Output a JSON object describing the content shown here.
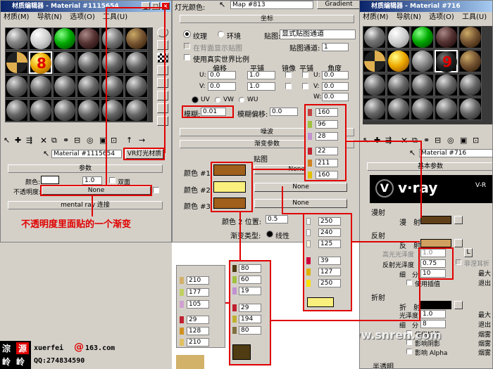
{
  "left": {
    "title": "材质编辑器 - Material #1115654",
    "menu": [
      "材质(M)",
      "导航(N)",
      "选项(O)",
      "工具(U)"
    ],
    "slot8": "8",
    "material_name": "Material #1115654",
    "material_type": "VR灯光材质",
    "params_header": "参数",
    "color_label": "颜色:",
    "color_value": "1.0",
    "double_sided": "双面",
    "opacity_label": "不透明度:",
    "opacity_value": "None",
    "mr_header": "mental ray 连接",
    "annotation": "不透明度里面贴的一个渐变",
    "watermark_name": "xuerfei",
    "watermark_domain": "163.com",
    "watermark_qq": "QQ:274834590",
    "stamp": [
      "淙",
      "源",
      "岭",
      "岭"
    ]
  },
  "middle": {
    "top_label": "灯光颜色:",
    "map_name": "Map #813",
    "map_type": "Gradient",
    "coords_header": "坐标",
    "texture": "纹理",
    "env": "环境",
    "map_label": "贴图:",
    "map_channel_opt": "显式贴图通道",
    "show_in_viewport": "在背面显示贴图",
    "map_channel_label": "贴图通道:",
    "map_channel_value": "1",
    "real_world": "使用真实世界比例",
    "col_offset": "偏移",
    "col_tiling": "平铺",
    "col_mirror": "镜像",
    "col_tile": "平铺",
    "col_angle": "角度",
    "u_label": "U:",
    "v_label": "V:",
    "w_label": "W:",
    "u_offset": "0.0",
    "v_offset": "0.0",
    "u_tiling": "1.0",
    "v_tiling": "1.0",
    "u_angle": "0.0",
    "v_angle": "0.0",
    "w_angle": "0.0",
    "uv": "UV",
    "vw": "VW",
    "wu": "WU",
    "blur_label": "模糊:",
    "blur_value": "0.01",
    "blur_offset_label": "模糊偏移:",
    "blur_offset_value": "0.0",
    "noise_header": "噪波",
    "gradient_header": "渐变参数",
    "maps_label": "贴图",
    "color1": "颜色 #1",
    "color2": "颜色 #2",
    "color3": "颜色 #3",
    "none": "None",
    "color2_pos_label": "颜色 2 位置:",
    "color2_pos_value": "0.5",
    "grad_type_label": "渐变类型:",
    "linear": "线性"
  },
  "right": {
    "title": "材质编辑器 - Material #716",
    "menu": [
      "材质(M)",
      "导航(N)",
      "选项(O)",
      "工具(U)"
    ],
    "slot9": "9",
    "material_name": "Material #716",
    "basic_header": "基本参数",
    "logo": "v·ray",
    "logo_right": "V-R",
    "diffuse_group": "漫射",
    "diffuse_label": "漫　射",
    "reflect_group": "反射",
    "reflect_label": "反　射",
    "hilight_gloss": "高光光泽度",
    "hilight_val": "1.0",
    "l_btn": "L",
    "fresnel": "菲涅耳折",
    "refl_gloss": "反射光泽度",
    "refl_gloss_val": "0.75",
    "subdivs": "细　分",
    "subdivs_val": "10",
    "max_depth": "最大",
    "exit": "退出",
    "use_interp": "使用插值",
    "refract_group": "折射",
    "refract_label": "折　射",
    "refr_gloss": "光泽度",
    "refr_gloss_val": "1.0",
    "refr_subdivs_val": "8",
    "use_interp2": "使用插值",
    "affect_shadow": "影响阴影",
    "affect_alpha": "影响 Alpha",
    "fog1": "烟雾",
    "fog2": "烟雾",
    "fog3": "烟雾",
    "translucent": "半透明",
    "site": "www.snren.com"
  },
  "rgb": {
    "p1": [
      "160",
      "96",
      "28",
      "22",
      "211",
      "160"
    ],
    "p2": [
      "250",
      "240",
      "125",
      "39",
      "127",
      "250"
    ],
    "p3": [
      "210",
      "177",
      "105",
      "29",
      "128",
      "210"
    ],
    "p4": [
      "80",
      "60",
      "19",
      "29",
      "194",
      "80"
    ]
  },
  "colors": {
    "c1": "#a0601c",
    "c2": "#faf07d",
    "c3": "#a0601c",
    "c4": "#d2b169",
    "c5": "#503c13",
    "diffuse": "#60401a",
    "reflect": "#d0a060",
    "refract": "#000000"
  }
}
